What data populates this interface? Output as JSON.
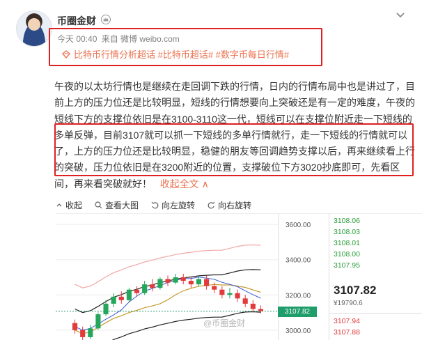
{
  "post": {
    "username": "币圈金财",
    "time": "今天 00:40",
    "source": "来自 微博 weibo.com",
    "topics": "比特币行情分析超话 #比特币超话# #数字币每日行情#",
    "body": "午夜的以太坊行情也是继续在走回调下跌的行情，日内的行情布局中也是讲过了，目前上方的压力位还是比较明显，短线的行情想要向上突破还是有一定的难度，午夜的短线下方的支撑位依旧是在3100-3110这一代，短线可以在支撑位附近走一下短线的多单反弹，目前3107就可以抓一下短线的多单行情就行，走一下短线的行情就可以了，上方的压力位还是比较明显，稳健的朋友等回调趋势支撑以后，再来继续看上行的突破，压力位依旧是在3200附近的位置，支撑破位下方3020抄底即可，先看区间，再来看突破就好！",
    "fold_label": "收起全文",
    "fold_arrow": "∧",
    "icons": {
      "vip": "crown-icon",
      "more": "chevron-down-icon",
      "topic": "topic-diamond-icon"
    }
  },
  "toolbar": {
    "collapse": "收起",
    "view_large": "查看大图",
    "rotate_left": "向左旋转",
    "rotate_right": "向右旋转"
  },
  "chart_data": {
    "type": "candlestick",
    "y_ticks": [
      "3600.00",
      "3400.00",
      "3200.00",
      "3000.00"
    ],
    "y_tick_values": [
      3600,
      3400,
      3200,
      3000
    ],
    "ylim": [
      2940,
      3660
    ],
    "current_price_tag": "3107.82",
    "support_level": 3107.82,
    "candles": [
      [
        3040,
        3000,
        3060,
        2980
      ],
      [
        3000,
        2960,
        3020,
        2940
      ],
      [
        2960,
        3010,
        3030,
        2950
      ],
      [
        3010,
        3090,
        3100,
        3000
      ],
      [
        3090,
        3150,
        3170,
        3080
      ],
      [
        3150,
        3190,
        3210,
        3130
      ],
      [
        3190,
        3170,
        3220,
        3150
      ],
      [
        3170,
        3230,
        3240,
        3160
      ],
      [
        3230,
        3210,
        3250,
        3190
      ],
      [
        3210,
        3260,
        3280,
        3200
      ],
      [
        3260,
        3240,
        3290,
        3220
      ],
      [
        3240,
        3290,
        3300,
        3230
      ],
      [
        3290,
        3270,
        3310,
        3250
      ],
      [
        3270,
        3300,
        3320,
        3260
      ],
      [
        3300,
        3280,
        3320,
        3260
      ],
      [
        3280,
        3260,
        3300,
        3240
      ],
      [
        3260,
        3290,
        3300,
        3250
      ],
      [
        3290,
        3250,
        3310,
        3230
      ],
      [
        3250,
        3230,
        3270,
        3210
      ],
      [
        3230,
        3200,
        3250,
        3180
      ],
      [
        3200,
        3210,
        3240,
        3180
      ],
      [
        3210,
        3180,
        3230,
        3160
      ],
      [
        3180,
        3150,
        3200,
        3130
      ],
      [
        3150,
        3120,
        3170,
        3100
      ],
      [
        3120,
        3108,
        3140,
        3095
      ]
    ],
    "watermark": "@币圈金财"
  },
  "quote_panel": {
    "asks": [
      "3108.06",
      "3108.03",
      "3108.01",
      "3108.00",
      "3107.95"
    ],
    "last_price": "3107.82",
    "volume": "¥19790.6",
    "bids": [
      "3107.94",
      "3107.88"
    ],
    "colors": {
      "up": "#2a9d3a",
      "down": "#e23b3b"
    }
  }
}
